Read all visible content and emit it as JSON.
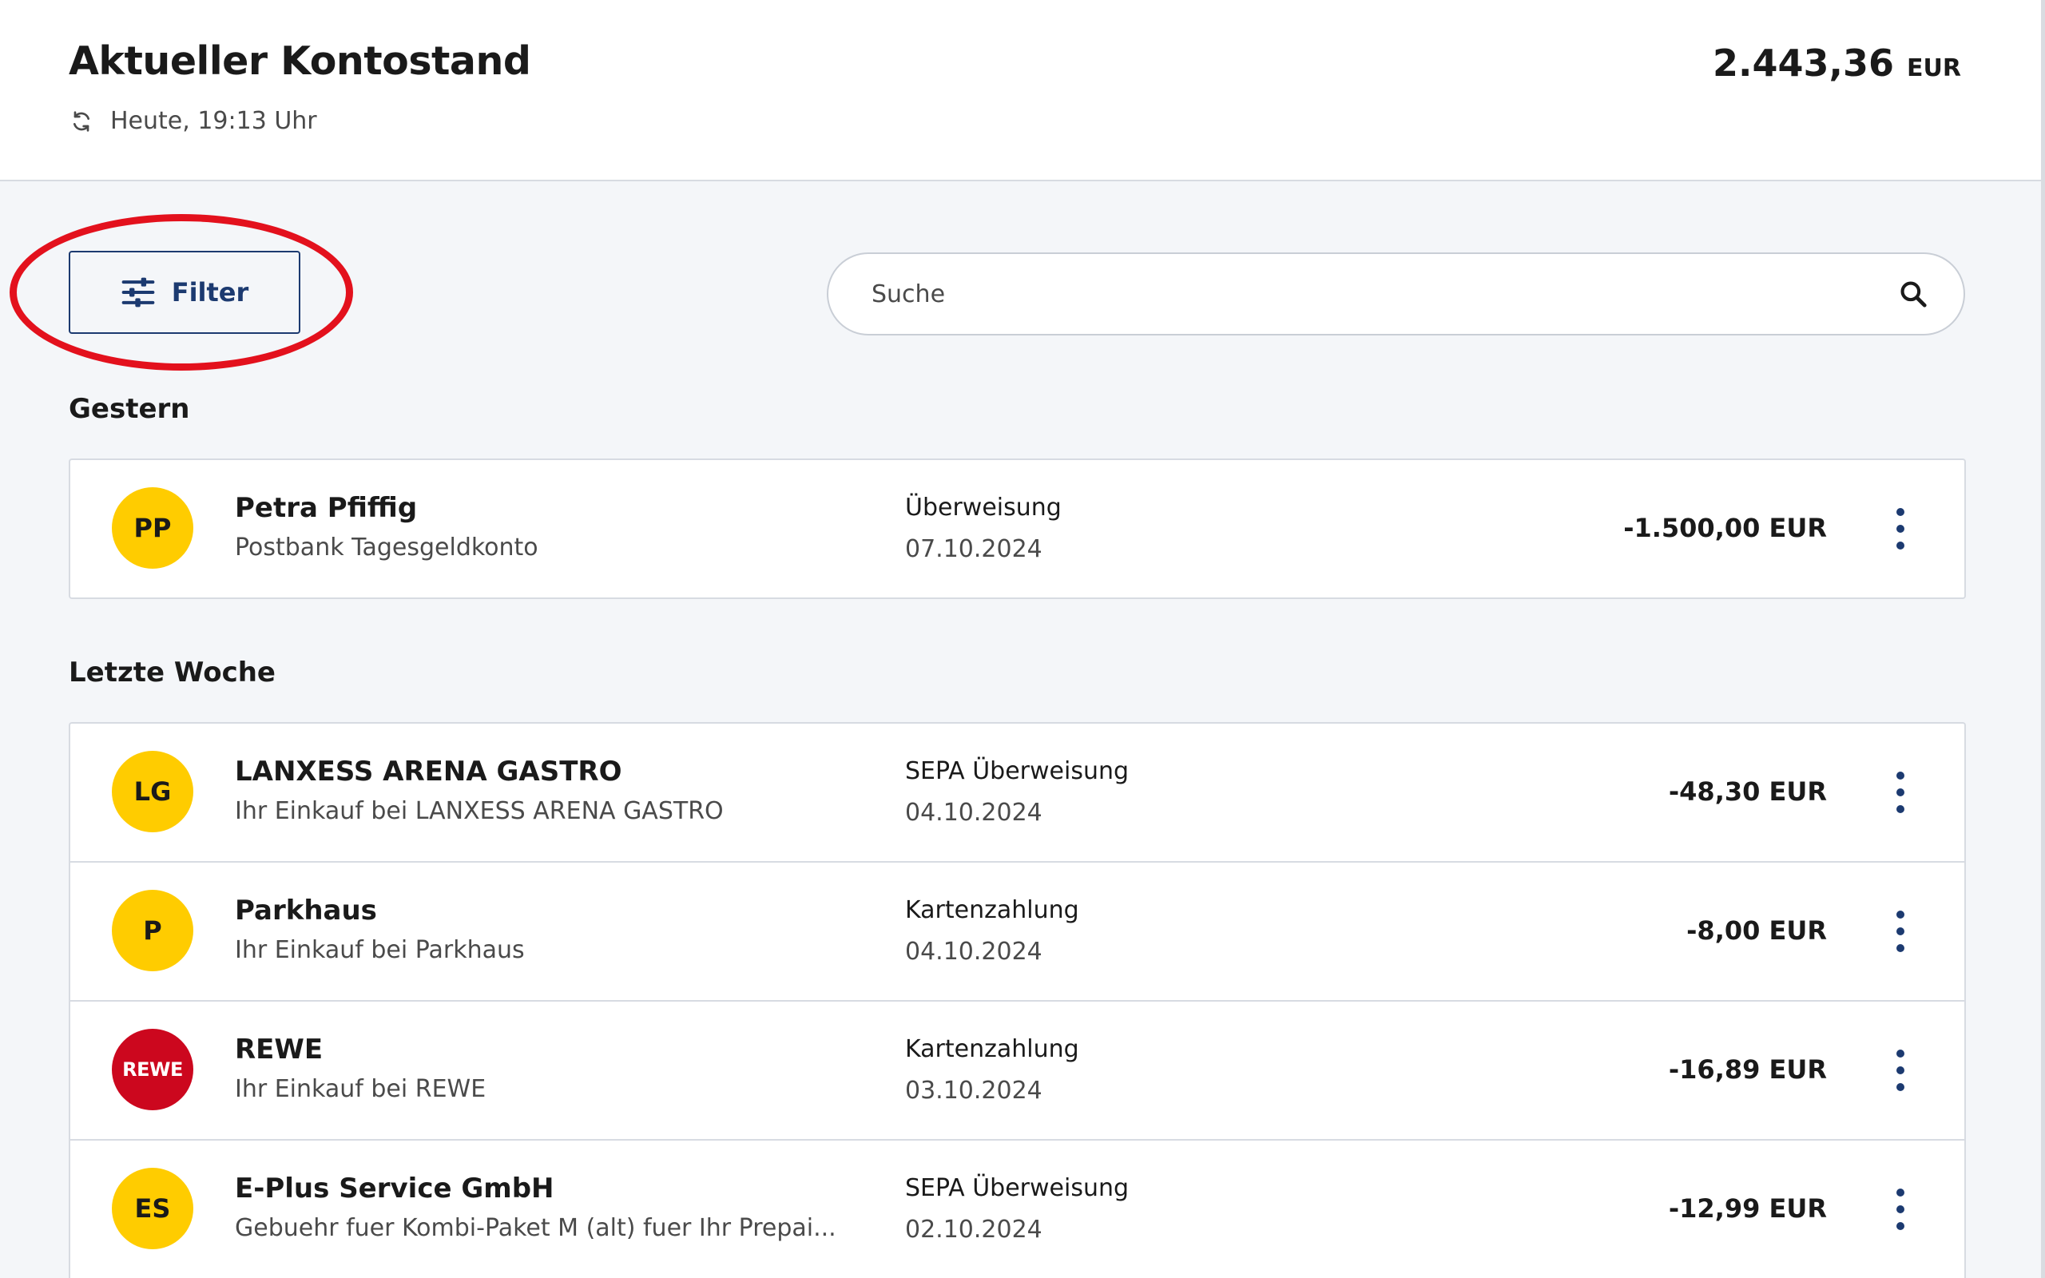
{
  "header": {
    "title": "Aktueller Kontostand",
    "updated": "Heute, 19:13 Uhr",
    "balance_value": "2.443,36",
    "balance_currency": "EUR"
  },
  "toolbar": {
    "filter_label": "Filter",
    "search_placeholder": "Suche",
    "search_value": ""
  },
  "groups": [
    {
      "title": "Gestern",
      "transactions": [
        {
          "initials": "PP",
          "name": "Petra Pfiffig",
          "description": "Postbank Tagesgeldkonto",
          "type": "Überweisung",
          "date": "07.10.2024",
          "amount": "-1.500,00 EUR"
        }
      ]
    },
    {
      "title": "Letzte Woche",
      "transactions": [
        {
          "initials": "LG",
          "name": "LANXESS ARENA GASTRO",
          "description": "Ihr Einkauf bei LANXESS ARENA GASTRO",
          "type": "SEPA Überweisung",
          "date": "04.10.2024",
          "amount": "-48,30 EUR"
        },
        {
          "initials": "P",
          "name": "Parkhaus",
          "description": "Ihr Einkauf bei Parkhaus",
          "type": "Kartenzahlung",
          "date": "04.10.2024",
          "amount": "-8,00 EUR"
        },
        {
          "initials": "REWE",
          "name": "REWE",
          "description": "Ihr Einkauf bei REWE",
          "type": "Kartenzahlung",
          "date": "03.10.2024",
          "amount": "-16,89 EUR"
        },
        {
          "initials": "ES",
          "name": "E-Plus Service GmbH",
          "description": "Gebuehr fuer Kombi-Paket M (alt) fuer Ihr Prepai...",
          "type": "SEPA Überweisung",
          "date": "02.10.2024",
          "amount": "-12,99 EUR"
        }
      ]
    }
  ],
  "colors": {
    "brand_yellow": "#ffcc00",
    "rewe_red": "#cc071e",
    "primary_blue": "#1c3a70",
    "highlight_red": "#e3111d"
  },
  "icons": {
    "refresh": "refresh-icon",
    "filter": "sliders-icon",
    "search": "search-icon",
    "more": "more-vertical-icon"
  }
}
